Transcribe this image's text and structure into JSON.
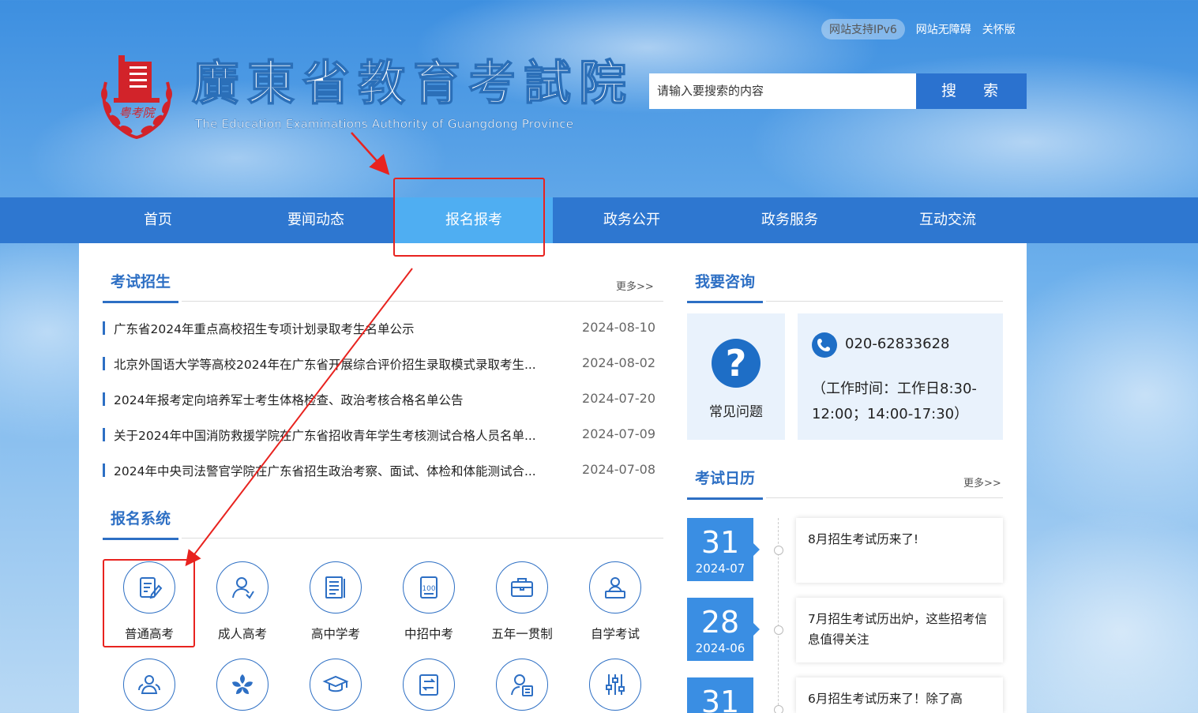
{
  "header": {
    "ipv6_badge": "网站支持IPv6",
    "accessibility_link": "网站无障碍",
    "care_link": "关怀版",
    "logo_emblem_text": "粤考院",
    "site_title": "廣東省教育考試院",
    "site_subtitle": "The Education Examinations Authority of Guangdong Province",
    "search_placeholder": "请输入要搜索的内容",
    "search_button": "搜 索"
  },
  "nav": {
    "items": [
      {
        "label": "首页"
      },
      {
        "label": "要闻动态"
      },
      {
        "label": "报名报考",
        "active": true
      },
      {
        "label": "政务公开"
      },
      {
        "label": "政务服务"
      },
      {
        "label": "互动交流"
      }
    ]
  },
  "exam_enrollment": {
    "title": "考试招生",
    "more": "更多>>",
    "news": [
      {
        "title": "广东省2024年重点高校招生专项计划录取考生名单公示",
        "date": "2024-08-10"
      },
      {
        "title": "北京外国语大学等高校2024年在广东省开展综合评价招生录取模式录取考生...",
        "date": "2024-08-02"
      },
      {
        "title": "2024年报考定向培养军士考生体格检查、政治考核合格名单公告",
        "date": "2024-07-20"
      },
      {
        "title": "关于2024年中国消防救援学院在广东省招收青年学生考核测试合格人员名单...",
        "date": "2024-07-09"
      },
      {
        "title": "2024年中央司法警官学院在广东省招生政治考察、面试、体检和体能测试合...",
        "date": "2024-07-08"
      }
    ]
  },
  "registration_system": {
    "title": "报名系统",
    "row1": [
      {
        "label": "普通高考",
        "icon": "exam-pencil-icon"
      },
      {
        "label": "成人高考",
        "icon": "adult-person-icon"
      },
      {
        "label": "高中学考",
        "icon": "document-list-icon"
      },
      {
        "label": "中招中考",
        "icon": "score-sheet-icon"
      },
      {
        "label": "五年一贯制",
        "icon": "briefcase-icon"
      },
      {
        "label": "自学考试",
        "icon": "self-study-icon"
      }
    ],
    "row2": [
      {
        "icon": "group-icon"
      },
      {
        "icon": "bauhinia-icon"
      },
      {
        "icon": "graduation-cap-icon"
      },
      {
        "icon": "transfer-doc-icon"
      },
      {
        "icon": "person-doc-icon"
      },
      {
        "icon": "sliders-icon"
      }
    ]
  },
  "consult": {
    "title": "我要咨询",
    "faq_label": "常见问题",
    "phone": "020-62833628",
    "work_hours": "（工作时间：工作日8:30-12:00；14:00-17:30）"
  },
  "calendar": {
    "title": "考试日历",
    "more": "更多>>",
    "entries": [
      {
        "day": "31",
        "ym": "2024-07",
        "text": "8月招生考试历来了!"
      },
      {
        "day": "28",
        "ym": "2024-06",
        "text": "7月招生考试历出炉，这些招考信息值得关注"
      },
      {
        "day": "31",
        "ym": "",
        "text": "6月招生考试历来了！除了高"
      }
    ]
  },
  "colors": {
    "nav_bg": "#2e77d0",
    "nav_active": "#4faef2",
    "accent": "#2d6fc4",
    "annotation_red": "#e8231f"
  }
}
